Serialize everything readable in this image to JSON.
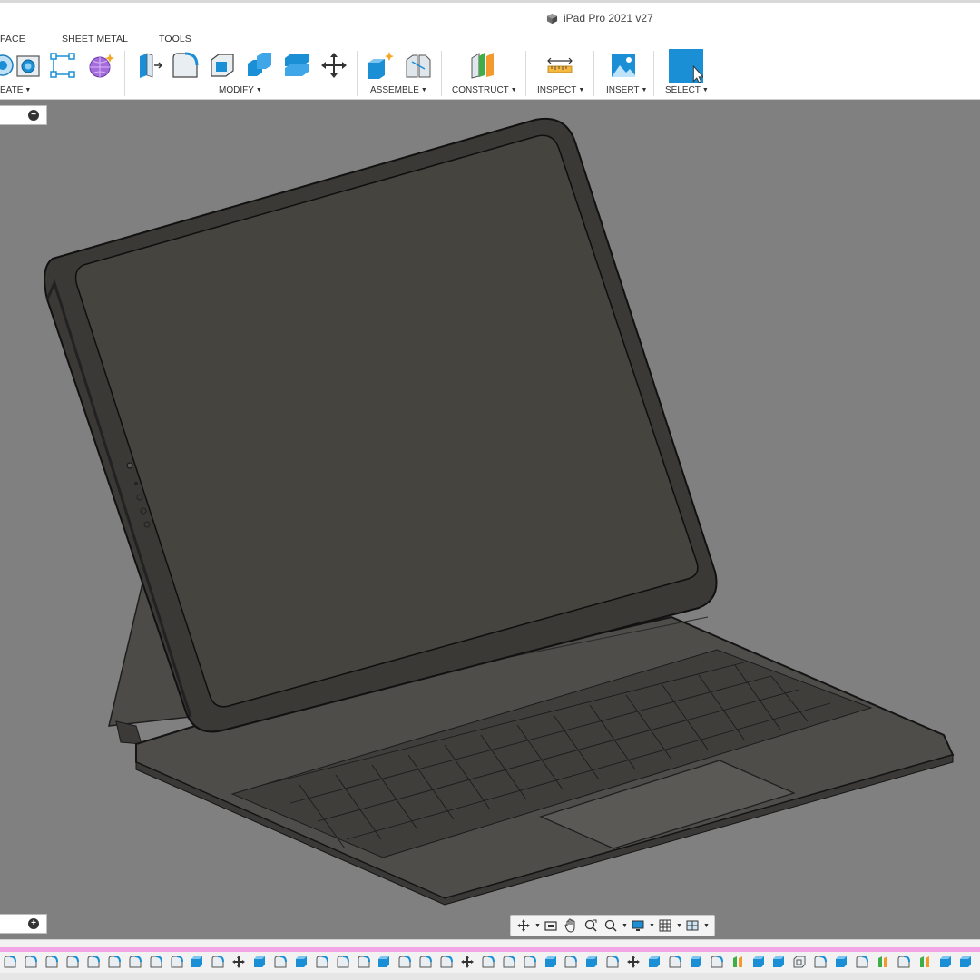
{
  "window": {
    "document_title": "iPad Pro 2021 v27"
  },
  "ribbon": {
    "tabs": [
      "FACE",
      "SHEET METAL",
      "TOOLS"
    ],
    "groups": {
      "create": "EATE",
      "modify": "MODIFY",
      "assemble": "ASSEMBLE",
      "construct": "CONSTRUCT",
      "inspect": "INSPECT",
      "insert": "INSERT",
      "select": "SELECT"
    },
    "tools": [
      {
        "name": "revolve-icon",
        "group": "create"
      },
      {
        "name": "hole-icon",
        "group": "create"
      },
      {
        "name": "pattern-icon",
        "group": "create"
      },
      {
        "name": "create-form-icon",
        "group": "create"
      },
      {
        "name": "press-pull-icon",
        "group": "modify"
      },
      {
        "name": "fillet-icon",
        "group": "modify"
      },
      {
        "name": "shell-icon",
        "group": "modify"
      },
      {
        "name": "combine-icon",
        "group": "modify"
      },
      {
        "name": "split-body-icon",
        "group": "modify"
      },
      {
        "name": "move-icon",
        "group": "modify"
      },
      {
        "name": "new-component-icon",
        "group": "assemble"
      },
      {
        "name": "joint-icon",
        "group": "assemble"
      },
      {
        "name": "offset-plane-icon",
        "group": "construct"
      },
      {
        "name": "measure-icon",
        "group": "inspect"
      },
      {
        "name": "insert-image-icon",
        "group": "insert"
      },
      {
        "name": "select-icon",
        "group": "select"
      }
    ],
    "colors": {
      "accent_blue": "#1a8fd6",
      "purple": "#9b59d6",
      "orange": "#f29a2e",
      "green": "#3fae49"
    }
  },
  "viewport": {
    "background": "#808080",
    "browser_toggle": "−",
    "comments_toggle": "+",
    "nav_tools": [
      "orbit-icon",
      "look-at-icon",
      "pan-icon",
      "zoom-window-icon",
      "zoom-icon",
      "display-settings-icon",
      "grid-settings-icon",
      "viewports-icon"
    ]
  },
  "timeline": {
    "track_color": "#f3a6e6",
    "item_count": 47
  }
}
